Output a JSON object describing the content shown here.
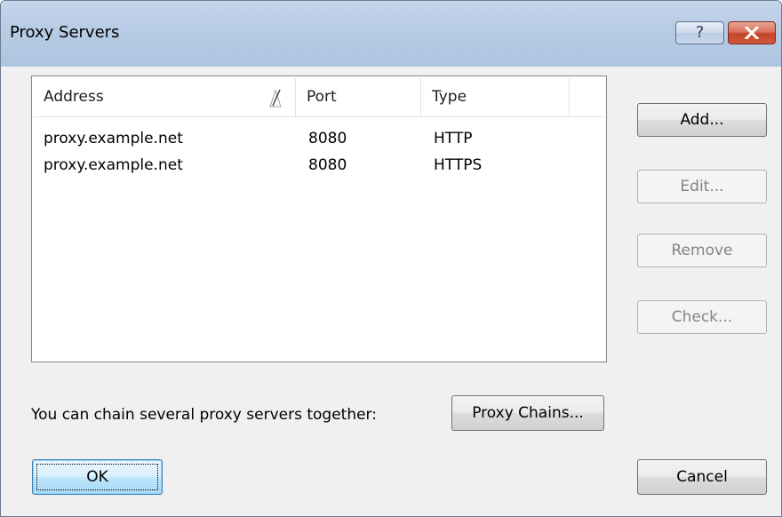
{
  "window": {
    "title": "Proxy Servers",
    "help_glyph": "?",
    "close_icon": "close-x-icon"
  },
  "list": {
    "columns": [
      "Address",
      "Port",
      "Type"
    ],
    "sort_column": "Address",
    "sort_direction": "ascending",
    "rows": [
      {
        "address": "proxy.example.net",
        "port": "8080",
        "type": "HTTP"
      },
      {
        "address": "proxy.example.net",
        "port": "8080",
        "type": "HTTPS"
      }
    ]
  },
  "buttons": {
    "add": "Add...",
    "edit": "Edit...",
    "remove": "Remove",
    "check": "Check...",
    "proxy_chains": "Proxy Chains...",
    "ok": "OK",
    "cancel": "Cancel"
  },
  "chain_label": "You can chain several proxy servers together:",
  "colors": {
    "titlebar": "#b9cde5",
    "close_button": "#c9503a",
    "ok_focus": "#3c7fb1",
    "disabled_text": "#838383"
  }
}
